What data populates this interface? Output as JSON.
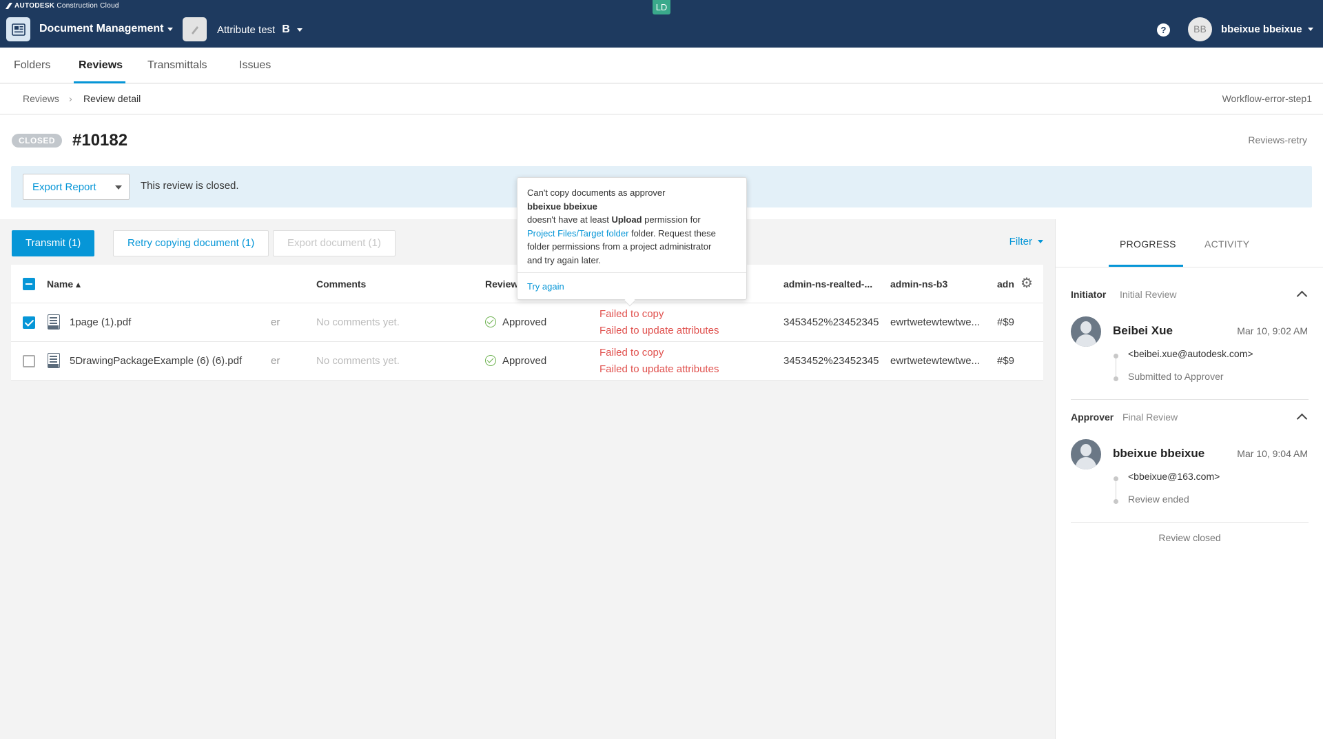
{
  "topbar": {
    "brand_bold": "AUTODESK",
    "brand_light": "Construction Cloud",
    "ld_badge": "LD",
    "app_name": "Document Management",
    "project_name": "Attribute test",
    "project_badge": "B",
    "help_icon": "?",
    "avatar_initials": "BB",
    "user_name": "bbeixue bbeixue"
  },
  "nav": {
    "tabs": [
      {
        "label": "Folders",
        "active": false
      },
      {
        "label": "Reviews",
        "active": true
      },
      {
        "label": "Transmittals",
        "active": false
      },
      {
        "label": "Issues",
        "active": false
      }
    ]
  },
  "breadcrumb": {
    "parent": "Reviews",
    "separator": "›",
    "current": "Review detail",
    "workflow_name": "Workflow-error-step1"
  },
  "header": {
    "status_badge": "CLOSED",
    "review_id": "#10182",
    "review_name": "Reviews-retry",
    "export_report_label": "Export Report",
    "closed_message": "This review is closed."
  },
  "toolbar": {
    "transmit_label": "Transmit (1)",
    "retry_label": "Retry copying document (1)",
    "export_label": "Export document (1)",
    "filter_label": "Filter"
  },
  "table": {
    "headers": {
      "name": "Name",
      "sort_indicator": "▴",
      "comments": "Comments",
      "review": "Review",
      "attr1": "admin-ns-realted-...",
      "attr2": "admin-ns-b3",
      "attr3": "adn"
    },
    "rows": [
      {
        "checked": true,
        "name": "1page (1).pdf",
        "truncated_col": "er",
        "comments": "No comments yet.",
        "review_status": "Approved",
        "error1": "Failed to copy",
        "error2": "Failed to update attributes",
        "attr1": "3453452%23452345",
        "attr2": "ewrtwetewtewtwe...",
        "attr3": "#$9"
      },
      {
        "checked": false,
        "name": "5DrawingPackageExample (6) (6).pdf",
        "truncated_col": "er",
        "comments": "No comments yet.",
        "review_status": "Approved",
        "error1": "Failed to copy",
        "error2": "Failed to update attributes",
        "attr1": "3453452%23452345",
        "attr2": "ewrtwetewtewtwe...",
        "attr3": "#$9"
      }
    ]
  },
  "tooltip": {
    "line1": "Can't copy documents as approver",
    "approver": "bbeixue bbeixue",
    "line3_pre": "doesn't have at least ",
    "line3_bold": "Upload",
    "line3_post": " permission for",
    "folder_link": "Project Files/Target folder",
    "line4_post": " folder. Request these",
    "line5": "folder permissions from a project administrator",
    "line6": "and try again later.",
    "action": "Try again"
  },
  "panel": {
    "tabs": [
      "PROGRESS",
      "ACTIVITY"
    ],
    "steps": [
      {
        "role": "Initiator",
        "step_name": "Initial Review",
        "person": "Beibei Xue",
        "time": "Mar 10, 9:02 AM",
        "email": "<beibei.xue@autodesk.com>",
        "status": "Submitted to Approver"
      },
      {
        "role": "Approver",
        "step_name": "Final Review",
        "person": "bbeixue bbeixue",
        "time": "Mar 10, 9:04 AM",
        "email": "<bbeixue@163.com>",
        "status": "Review ended"
      }
    ],
    "footer": "Review closed"
  },
  "colors": {
    "topbar": "#1e3a5f",
    "accent": "#0696d7",
    "error": "#e0514e",
    "success": "#6ab04c",
    "ld_badge": "#3aa98b"
  }
}
